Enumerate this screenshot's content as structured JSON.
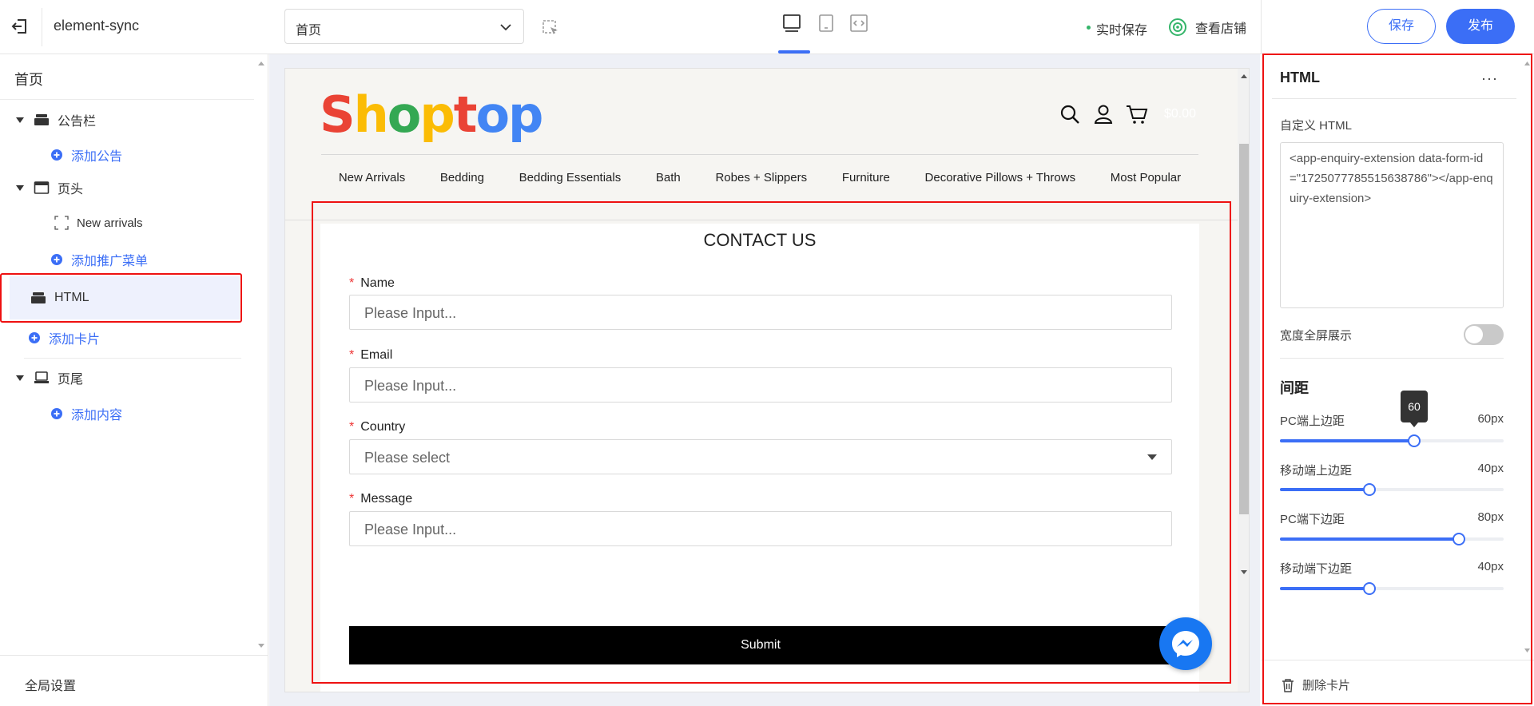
{
  "topbar": {
    "site_name": "element-sync",
    "page_select_value": "首页",
    "realtime_save": "实时保存",
    "view_store": "查看店铺",
    "save_label": "保存",
    "publish_label": "发布"
  },
  "sidebar": {
    "title": "首页",
    "items": [
      {
        "label": "公告栏",
        "icon": "layers-icon"
      },
      {
        "label": "添加公告"
      },
      {
        "label": "页头",
        "icon": "window-icon"
      },
      {
        "label": "New arrivals",
        "icon": "dashed-box-icon"
      },
      {
        "label": "添加推广菜单"
      },
      {
        "label": "HTML",
        "icon": "layers-icon"
      },
      {
        "label": "添加卡片"
      },
      {
        "label": "页尾",
        "icon": "laptop-icon"
      },
      {
        "label": "添加内容"
      }
    ],
    "footer_label": "全局设置"
  },
  "preview": {
    "logo_letters": [
      {
        "ch": "S",
        "color": "#ea4335"
      },
      {
        "ch": "h",
        "color": "#fbbc05"
      },
      {
        "ch": "o",
        "color": "#34a853"
      },
      {
        "ch": "p",
        "color": "#fbbc05"
      },
      {
        "ch": "t",
        "color": "#ea4335"
      },
      {
        "ch": "o",
        "color": "#4285f4"
      },
      {
        "ch": "p",
        "color": "#4285f4"
      }
    ],
    "cart_price": "$0.00",
    "nav": [
      "New Arrivals",
      "Bedding",
      "Bedding Essentials",
      "Bath",
      "Robes + Slippers",
      "Furniture",
      "Decorative Pillows + Throws",
      "Most Popular"
    ],
    "form": {
      "title": "CONTACT US",
      "fields": [
        {
          "label": "Name",
          "placeholder": "Please Input..."
        },
        {
          "label": "Email",
          "placeholder": "Please Input..."
        },
        {
          "label": "Country",
          "placeholder": "Please select"
        },
        {
          "label": "Message",
          "placeholder": "Please Input..."
        }
      ],
      "submit": "Submit"
    }
  },
  "panel": {
    "title": "HTML",
    "more": "···",
    "custom_html_label": "自定义 HTML",
    "custom_html_value": "<app-enquiry-extension data-form-id=\"1725077785515638786\"></app-enquiry-extension>",
    "fullwidth_label": "宽度全屏展示",
    "fullwidth_on": false,
    "spacing_title": "间距",
    "sliders": [
      {
        "label": "PC端上边距",
        "value": "60px",
        "fraction": 0.6
      },
      {
        "label": "移动端上边距",
        "value": "40px",
        "fraction": 0.4
      },
      {
        "label": "PC端下边距",
        "value": "80px",
        "fraction": 0.8
      },
      {
        "label": "移动端下边距",
        "value": "40px",
        "fraction": 0.4
      }
    ],
    "tooltip": "60",
    "delete_label": "删除卡片"
  },
  "colors": {
    "accent": "#3b6ef6",
    "highlight_border": "#e11111",
    "messenger": "#1877f2"
  }
}
